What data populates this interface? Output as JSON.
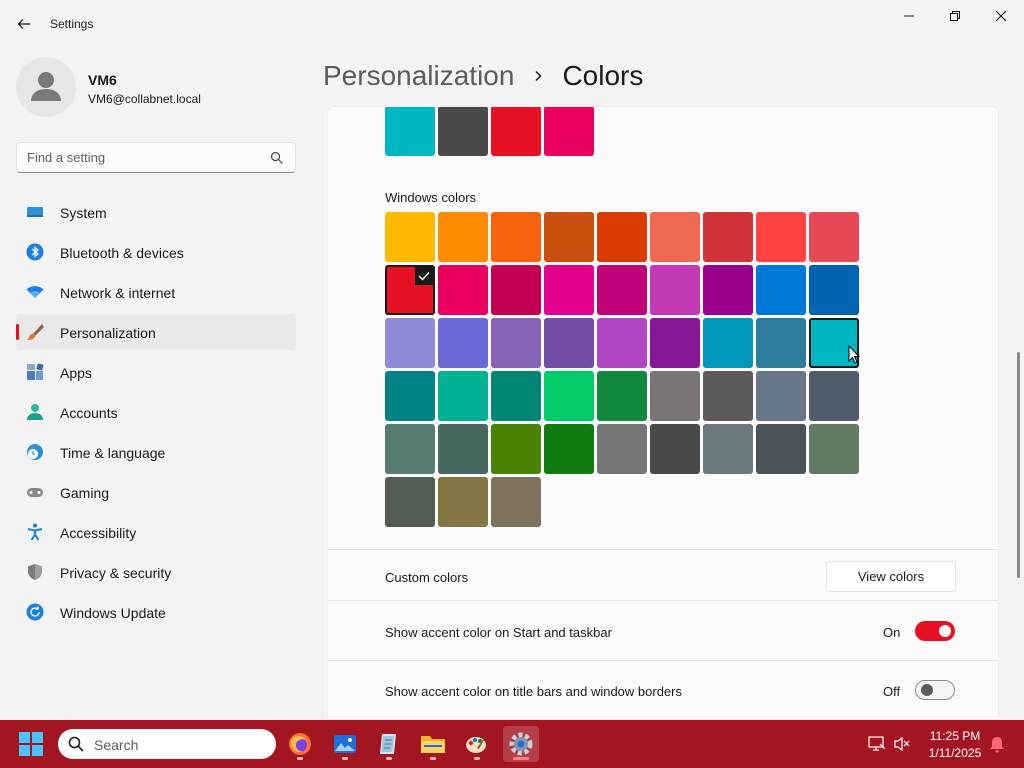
{
  "window": {
    "app_title": "Settings"
  },
  "profile": {
    "name": "VM6",
    "email": "VM6@collabnet.local"
  },
  "search": {
    "placeholder": "Find a setting"
  },
  "sidebar": {
    "items": [
      {
        "label": "System",
        "icon": "monitor-icon",
        "active": false
      },
      {
        "label": "Bluetooth & devices",
        "icon": "bluetooth-icon",
        "active": false
      },
      {
        "label": "Network & internet",
        "icon": "wifi-icon",
        "active": false
      },
      {
        "label": "Personalization",
        "icon": "paintbrush-icon",
        "active": true
      },
      {
        "label": "Apps",
        "icon": "apps-icon",
        "active": false
      },
      {
        "label": "Accounts",
        "icon": "person-icon",
        "active": false
      },
      {
        "label": "Time & language",
        "icon": "globe-clock-icon",
        "active": false
      },
      {
        "label": "Gaming",
        "icon": "gamepad-icon",
        "active": false
      },
      {
        "label": "Accessibility",
        "icon": "accessibility-icon",
        "active": false
      },
      {
        "label": "Privacy & security",
        "icon": "shield-icon",
        "active": false
      },
      {
        "label": "Windows Update",
        "icon": "update-icon",
        "active": false
      }
    ]
  },
  "header": {
    "parent": "Personalization",
    "current": "Colors"
  },
  "recent_colors": [
    "#00b7c3",
    "#4c4a48",
    "#e81123",
    "#ea005e"
  ],
  "windows_colors": {
    "label": "Windows colors",
    "selected_index": 9,
    "hovered_index": 26,
    "swatches": [
      "#ffb900",
      "#ff8c00",
      "#f7630c",
      "#ca5010",
      "#da3b01",
      "#ef6950",
      "#d13438",
      "#ff4343",
      "#e74856",
      "#e81123",
      "#ea005e",
      "#c30052",
      "#e3008c",
      "#bf0077",
      "#c239b3",
      "#9a0089",
      "#0078d7",
      "#0063b1",
      "#8e8cd8",
      "#6b69d6",
      "#8764b8",
      "#744da9",
      "#b146c2",
      "#881798",
      "#0099bc",
      "#2d7d9a",
      "#00b7c3",
      "#038387",
      "#00b294",
      "#018574",
      "#00cc6a",
      "#10893e",
      "#7a7574",
      "#5d5a58",
      "#68768a",
      "#515c6b",
      "#567c73",
      "#486860",
      "#498205",
      "#107c10",
      "#767676",
      "#4c4a48",
      "#69797e",
      "#4a5459",
      "#647c64",
      "#525e54",
      "#847545",
      "#7e735f"
    ]
  },
  "custom_colors": {
    "label": "Custom colors",
    "button": "View colors"
  },
  "accent_start": {
    "label": "Show accent color on Start and taskbar",
    "state": "On"
  },
  "accent_titlebars": {
    "label": "Show accent color on title bars and window borders",
    "state": "Off"
  },
  "taskbar": {
    "search_label": "Search",
    "apps": [
      "firefox-icon",
      "photos-icon",
      "notepad-icon",
      "file-explorer-icon",
      "paint-icon",
      "settings-icon"
    ],
    "time": "11:25 PM",
    "date": "1/11/2025",
    "accent_color": "#a31520"
  }
}
